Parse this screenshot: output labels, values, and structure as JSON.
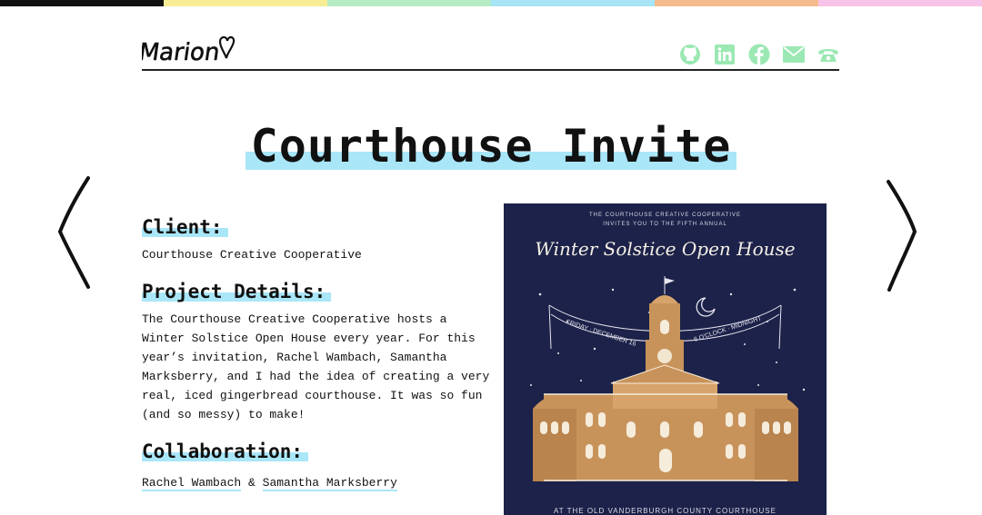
{
  "colors": {
    "accent_highlight": "#a9e6f8",
    "social_icon": "#9be8b3",
    "card_bg": "#1c2249",
    "topbar": [
      "#111111",
      "#f8ec95",
      "#b6ecc4",
      "#a7e4f6",
      "#f6bc8d",
      "#f8c3e8"
    ]
  },
  "header": {
    "logo_text": "Marion",
    "social": [
      {
        "icon": "github-icon"
      },
      {
        "icon": "linkedin-icon"
      },
      {
        "icon": "facebook-icon"
      },
      {
        "icon": "mail-icon"
      },
      {
        "icon": "phone-icon"
      }
    ]
  },
  "page": {
    "title": "Courthouse Invite",
    "prev_icon": "chevron-left-icon",
    "next_icon": "chevron-right-icon"
  },
  "details": {
    "client_heading": "Client:",
    "client_value": "Courthouse Creative Cooperative",
    "project_heading": "Project Details:",
    "project_text": "The Courthouse Creative Cooperative hosts a Winter Solstice Open House every year. For this year’s invitation, Rachel Wambach, Samantha Marksberry, and I had the idea of creating a very real, iced gingerbread courthouse. It was so fun (and so messy) to make!",
    "collab_heading": "Collaboration:",
    "collaborators": [
      "Rachel Wambach",
      "Samantha Marksberry"
    ],
    "collab_sep": "&"
  },
  "invite": {
    "line1": "THE COURTHOUSE CREATIVE COOPERATIVE",
    "line2": "INVITES YOU TO THE FIFTH ANNUAL",
    "script_title": "Winter Solstice Open House",
    "banner_left": "FRIDAY · DECEMBER 16",
    "banner_right": "6 O'CLOCK · MIDNIGHT",
    "bottom_line": "AT THE OLD VANDERBURGH COUNTY COURTHOUSE"
  }
}
